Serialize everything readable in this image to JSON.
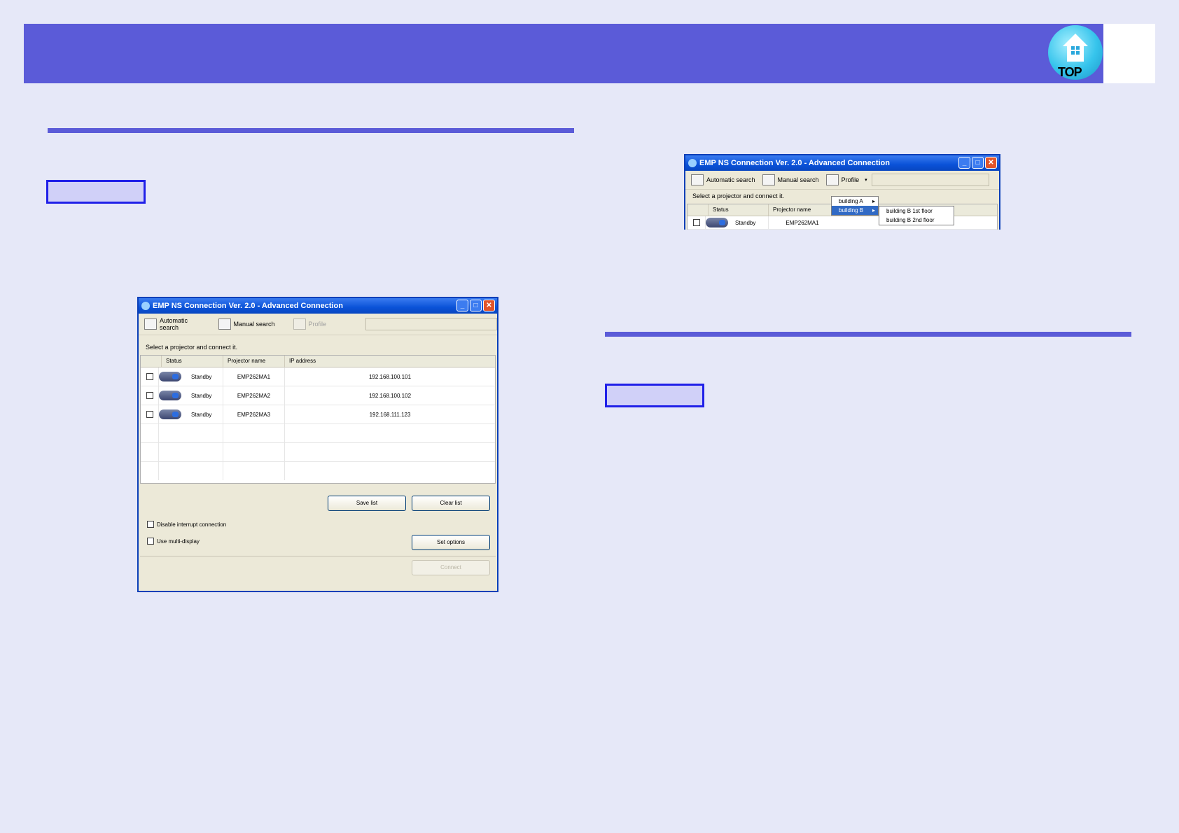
{
  "header": {
    "top_label": "TOP"
  },
  "window_main": {
    "title": "EMP NS Connection Ver. 2.0 - Advanced Connection",
    "toolbar": {
      "auto_search": "Automatic search",
      "manual_search": "Manual search",
      "profile": "Profile"
    },
    "instruction": "Select a projector and connect it.",
    "columns": [
      "Status",
      "Projector name",
      "IP address"
    ],
    "rows": [
      {
        "status": "Standby",
        "name": "EMP262MA1",
        "ip": "192.168.100.101"
      },
      {
        "status": "Standby",
        "name": "EMP262MA2",
        "ip": "192.168.100.102"
      },
      {
        "status": "Standby",
        "name": "EMP262MA3",
        "ip": "192.168.111.123"
      }
    ],
    "buttons": {
      "save_list": "Save list",
      "clear_list": "Clear list",
      "set_options": "Set options",
      "connect": "Connect"
    },
    "checkboxes": {
      "disable_interrupt": "Disable interrupt connection",
      "multi_display": "Use multi-display"
    }
  },
  "window_small": {
    "title": "EMP NS Connection Ver. 2.0 - Advanced Connection",
    "toolbar": {
      "auto_search": "Automatic search",
      "manual_search": "Manual search",
      "profile": "Profile"
    },
    "instruction": "Select a projector and connect it.",
    "columns": [
      "Status",
      "Projector name"
    ],
    "row": {
      "status": "Standby",
      "name": "EMP262MA1"
    },
    "menu": [
      "building A",
      "building B"
    ],
    "submenu": [
      "building B 1st floor",
      "building B 2nd floor"
    ]
  }
}
